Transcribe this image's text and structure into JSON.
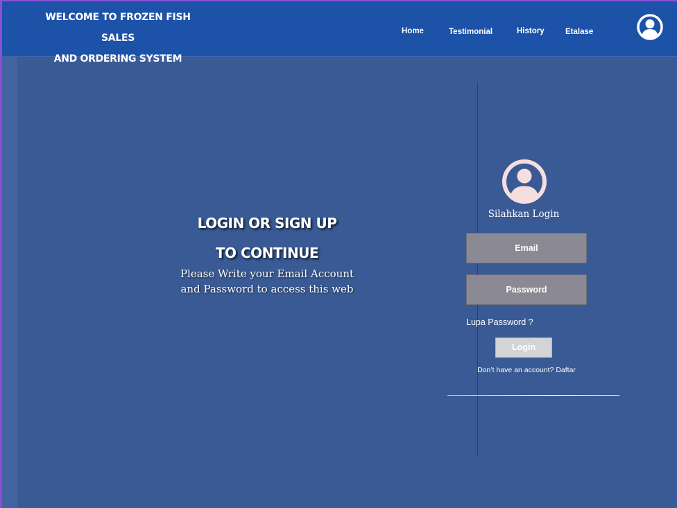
{
  "header": {
    "brand_line1": "WELCOME TO FROZEN FISH SALES",
    "brand_line2": "AND ORDERING SYSTEM",
    "nav": {
      "home": "Home",
      "testimonial": "Testimonial",
      "history": "History",
      "etalase": "Etalase"
    },
    "account_icon": "user-circle-icon"
  },
  "hero": {
    "title_line1": "LOGIN OR SIGN UP",
    "title_line2": "TO CONTINUE",
    "subtitle_line1": "Please Write your Email Account",
    "subtitle_line2": "and Password to access this web"
  },
  "login": {
    "avatar_icon": "user-circle-icon",
    "prompt": "Silahkan Login",
    "email_placeholder": "Email",
    "password_placeholder": "Password",
    "forgot": "Lupa Password ?",
    "button": "Login",
    "signup": "Don’t have an account? Daftar"
  },
  "colors": {
    "header_bg": "#1c52a8",
    "page_bg": "#395a94",
    "field_bg": "#8b8a94",
    "button_bg": "#d4d4d6",
    "avatar": "#f6dede"
  }
}
